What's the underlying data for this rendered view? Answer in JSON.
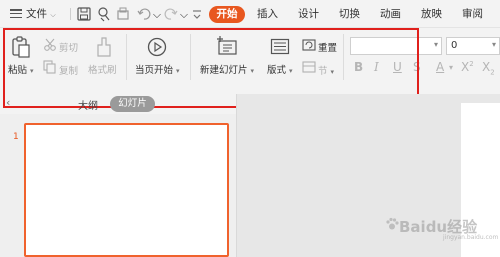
{
  "menubar": {
    "file_label": "文件",
    "tabs": [
      "开始",
      "插入",
      "设计",
      "切换",
      "动画",
      "放映",
      "审阅"
    ],
    "active_tab": "开始"
  },
  "ribbon": {
    "paste": "粘贴",
    "cut": "剪切",
    "copy": "复制",
    "format_painter": "格式刷",
    "from_current": "当页开始",
    "new_slide": "新建幻灯片",
    "layout": "版式",
    "reset": "重置",
    "section": "节",
    "font_size_value": "0"
  },
  "panel": {
    "outline_tab": "大纲",
    "slides_tab": "幻灯片",
    "slide_number": "1"
  },
  "watermark": {
    "text": "Baidu经验",
    "sub": "jingyan.baidu.com"
  },
  "colors": {
    "accent": "#e8571f",
    "highlight": "#e0201c"
  }
}
